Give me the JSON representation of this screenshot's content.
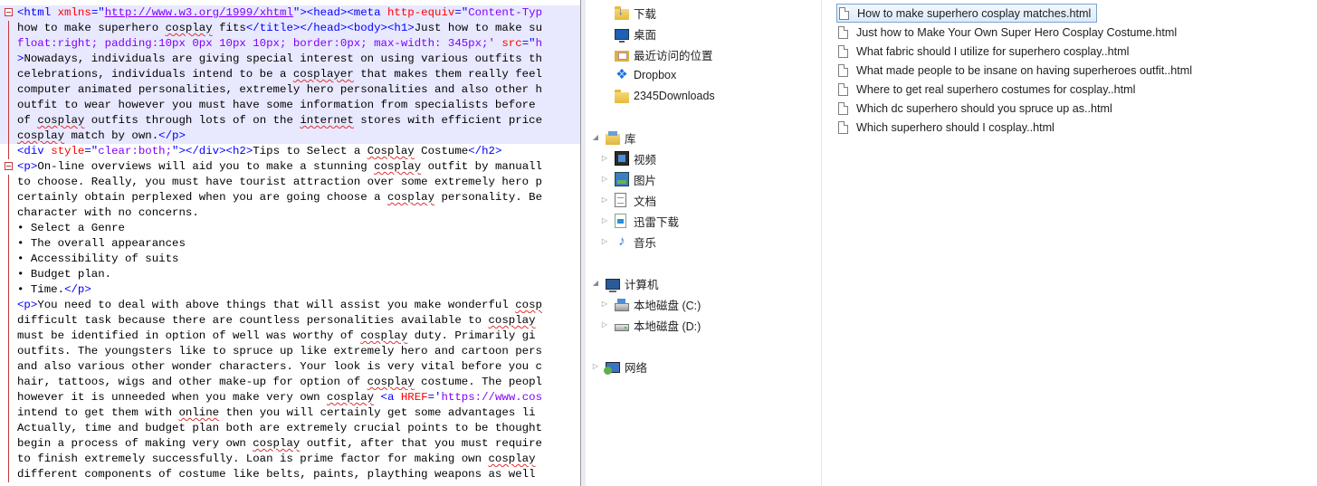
{
  "editor": {
    "lines": [
      {
        "hl": true,
        "fold": "box",
        "parts": [
          [
            "tg",
            "<html "
          ],
          [
            "at",
            "xmlns"
          ],
          [
            "tg",
            "=\""
          ],
          [
            "lk",
            "http://www.w3.org/1999/xhtml"
          ],
          [
            "tg",
            "\"><head><meta "
          ],
          [
            "at",
            "http-equiv"
          ],
          [
            "tg",
            "=\""
          ],
          [
            "av",
            "Content-Typ"
          ]
        ]
      },
      {
        "hl": true,
        "fold": "line",
        "parts": [
          [
            "",
            "how to make superhero "
          ],
          [
            "sq",
            "cosplay"
          ],
          [
            "",
            " fits"
          ],
          [
            "tg",
            "</title></head><body><h1>"
          ],
          [
            "",
            "Just how to make su"
          ]
        ]
      },
      {
        "hl": true,
        "fold": "line",
        "parts": [
          [
            "av",
            "float:right; padding:10px 0px 10px 10px; border:0px; max-width: 345px;' "
          ],
          [
            "at",
            "src"
          ],
          [
            "tg",
            "=\""
          ],
          [
            "av",
            "h"
          ]
        ]
      },
      {
        "hl": true,
        "fold": "line",
        "parts": [
          [
            "tg",
            ">"
          ],
          [
            "",
            "Nowadays, individuals are giving special interest on using various outfits th"
          ]
        ]
      },
      {
        "hl": true,
        "fold": "line",
        "parts": [
          [
            "",
            "celebrations, individuals intend to be a "
          ],
          [
            "sq",
            "cosplayer"
          ],
          [
            "",
            " that makes them really feel"
          ]
        ]
      },
      {
        "hl": true,
        "fold": "line",
        "parts": [
          [
            "",
            "computer animated personalities, extremely hero personalities and also other h"
          ]
        ]
      },
      {
        "hl": true,
        "fold": "line",
        "parts": [
          [
            "",
            "outfit to wear however you must have some information from specialists before"
          ]
        ]
      },
      {
        "hl": true,
        "fold": "line",
        "parts": [
          [
            "",
            "of "
          ],
          [
            "sq",
            "cosplay"
          ],
          [
            "",
            " outfits through lots of on the "
          ],
          [
            "sq",
            "internet"
          ],
          [
            "",
            " stores with efficient price"
          ]
        ]
      },
      {
        "hl": true,
        "fold": "line",
        "parts": [
          [
            "sq",
            "cosplay"
          ],
          [
            "",
            " match by own."
          ],
          [
            "tg",
            "</p>"
          ]
        ]
      },
      {
        "hl": false,
        "fold": "line",
        "parts": [
          [
            "tg",
            "<div "
          ],
          [
            "at",
            "style"
          ],
          [
            "tg",
            "=\""
          ],
          [
            "av",
            "clear:both;"
          ],
          [
            "tg",
            "\"></div><h2>"
          ],
          [
            "",
            "Tips to Select a "
          ],
          [
            "sq",
            "Cosplay"
          ],
          [
            "",
            " Costume"
          ],
          [
            "tg",
            "</h2>"
          ]
        ]
      },
      {
        "hl": false,
        "fold": "box",
        "parts": [
          [
            "tg",
            "<p>"
          ],
          [
            "",
            "On-line overviews will aid you to make a stunning "
          ],
          [
            "sq",
            "cosplay"
          ],
          [
            "",
            " outfit by manuall"
          ]
        ]
      },
      {
        "hl": false,
        "fold": "line",
        "parts": [
          [
            "",
            "to choose. Really, you must have tourist attraction over some extremely hero p"
          ]
        ]
      },
      {
        "hl": false,
        "fold": "line",
        "parts": [
          [
            "",
            "certainly obtain perplexed when you are going choose a "
          ],
          [
            "sq",
            "cosplay"
          ],
          [
            "",
            " personality. Be"
          ]
        ]
      },
      {
        "hl": false,
        "fold": "line",
        "parts": [
          [
            "",
            "character with no concerns."
          ]
        ]
      },
      {
        "hl": false,
        "fold": "line",
        "parts": [
          [
            "",
            "• Select a Genre"
          ]
        ]
      },
      {
        "hl": false,
        "fold": "line",
        "parts": [
          [
            "",
            "• The overall appearances"
          ]
        ]
      },
      {
        "hl": false,
        "fold": "line",
        "parts": [
          [
            "",
            "• Accessibility of suits"
          ]
        ]
      },
      {
        "hl": false,
        "fold": "line",
        "parts": [
          [
            "",
            "• Budget plan."
          ]
        ]
      },
      {
        "hl": false,
        "fold": "line",
        "parts": [
          [
            "",
            "• Time."
          ],
          [
            "tg",
            "</p>"
          ]
        ]
      },
      {
        "hl": false,
        "fold": "line",
        "parts": [
          [
            "tg",
            "<p>"
          ],
          [
            "",
            "You need to deal with above things that will assist you make wonderful "
          ],
          [
            "sq",
            "cosp"
          ]
        ]
      },
      {
        "hl": false,
        "fold": "line",
        "parts": [
          [
            "",
            "difficult task because there are countless personalities available to "
          ],
          [
            "sq",
            "cosplay"
          ]
        ]
      },
      {
        "hl": false,
        "fold": "line",
        "parts": [
          [
            "",
            "must be identified in option of well was worthy of "
          ],
          [
            "sq",
            "cosplay"
          ],
          [
            "",
            " duty. Primarily gi"
          ]
        ]
      },
      {
        "hl": false,
        "fold": "line",
        "parts": [
          [
            "",
            "outfits. The youngsters like to spruce up like extremely hero and cartoon pers"
          ]
        ]
      },
      {
        "hl": false,
        "fold": "line",
        "parts": [
          [
            "",
            "and also various other wonder characters. Your look is very vital before you c"
          ]
        ]
      },
      {
        "hl": false,
        "fold": "line",
        "parts": [
          [
            "",
            "hair, tattoos, wigs and other make-up for option of "
          ],
          [
            "sq",
            "cosplay"
          ],
          [
            "",
            " costume. The peopl"
          ]
        ]
      },
      {
        "hl": false,
        "fold": "line",
        "parts": [
          [
            "",
            "however it is unneeded when you make very own "
          ],
          [
            "sq",
            "cosplay"
          ],
          [
            "",
            " "
          ],
          [
            "tg",
            "<a "
          ],
          [
            "at",
            "HREF"
          ],
          [
            "tg",
            "='"
          ],
          [
            "av",
            "https://www.cos"
          ]
        ]
      },
      {
        "hl": false,
        "fold": "line",
        "parts": [
          [
            "",
            "intend to get them with "
          ],
          [
            "sq",
            "online"
          ],
          [
            "",
            " then you will certainly get some advantages li"
          ]
        ]
      },
      {
        "hl": false,
        "fold": "line",
        "parts": [
          [
            "",
            "Actually, time and budget plan both are extremely crucial points to be thought"
          ]
        ]
      },
      {
        "hl": false,
        "fold": "line",
        "parts": [
          [
            "",
            "begin a process of making very own "
          ],
          [
            "sq",
            "cosplay"
          ],
          [
            "",
            " outfit, after that you must require"
          ]
        ]
      },
      {
        "hl": false,
        "fold": "line",
        "parts": [
          [
            "",
            "to finish extremely successfully. Loan is prime factor for making own "
          ],
          [
            "sq",
            "cosplay"
          ]
        ]
      },
      {
        "hl": false,
        "fold": "line",
        "parts": [
          [
            "",
            "different components of costume like belts, paints, plaything weapons as well"
          ]
        ]
      }
    ]
  },
  "nav": {
    "favorites": [
      {
        "label": "下载",
        "icon": "downloads-folder-icon"
      },
      {
        "label": "桌面",
        "icon": "desktop-icon"
      },
      {
        "label": "最近访问的位置",
        "icon": "recent-places-icon"
      },
      {
        "label": "Dropbox",
        "icon": "dropbox-icon"
      },
      {
        "label": "2345Downloads",
        "icon": "folder-icon"
      }
    ],
    "libraries": {
      "label": "库",
      "icon": "libraries-icon"
    },
    "library_items": [
      {
        "label": "视频",
        "icon": "videos-icon"
      },
      {
        "label": "图片",
        "icon": "pictures-icon"
      },
      {
        "label": "文档",
        "icon": "documents-icon"
      },
      {
        "label": "迅雷下载",
        "icon": "thunder-downloads-icon"
      },
      {
        "label": "音乐",
        "icon": "music-icon"
      }
    ],
    "computer": {
      "label": "计算机",
      "icon": "computer-icon"
    },
    "drives": [
      {
        "label": "本地磁盘 (C:)",
        "icon": "local-disk-c-icon"
      },
      {
        "label": "本地磁盘 (D:)",
        "icon": "local-disk-d-icon"
      }
    ],
    "network": {
      "label": "网络",
      "icon": "network-icon"
    }
  },
  "files": [
    {
      "name": "How to make superhero cosplay matches.html",
      "selected": true
    },
    {
      "name": "Just how to Make Your Own Super Hero Cosplay Costume.html",
      "selected": false
    },
    {
      "name": "What fabric should I utilize for superhero cosplay..html",
      "selected": false
    },
    {
      "name": "What made people to be insane on having superheroes outfit..html",
      "selected": false
    },
    {
      "name": "Where to get real superhero costumes for cosplay..html",
      "selected": false
    },
    {
      "name": "Which dc superhero should you spruce up as..html",
      "selected": false
    },
    {
      "name": "Which superhero should I cosplay..html",
      "selected": false
    }
  ],
  "colors": {
    "selection_border": "#7da2ce",
    "editor_highlight": "#e8e8ff",
    "tag": "#0000ff",
    "attribute": "#ff0000",
    "attribute_value": "#8000ff"
  }
}
